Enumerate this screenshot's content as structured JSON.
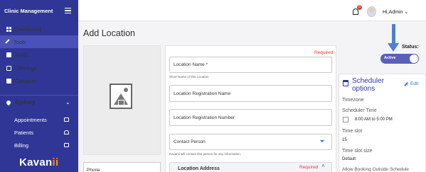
{
  "sidebar": {
    "title": "Clinic Management",
    "items": [
      {
        "label": "Dashboard",
        "icon": "dashboard-icon"
      },
      {
        "label": "Tools",
        "icon": "wrench-icon"
      },
      {
        "label": "Staffs",
        "icon": "staff-icon"
      },
      {
        "label": "Offerings",
        "icon": "offerings-icon"
      },
      {
        "label": "Contacts",
        "icon": "contacts-icon"
      }
    ],
    "location": "Sydney",
    "sub_items": [
      {
        "label": "Appointments",
        "icon": "calendar-icon"
      },
      {
        "label": "Patients",
        "icon": "people-icon"
      },
      {
        "label": "Billing",
        "icon": "card-icon"
      }
    ],
    "logo_main": "Kavan",
    "logo_accent": "ii"
  },
  "topbar": {
    "notification_count": "0",
    "user_greeting": "Hi,Admin"
  },
  "page": {
    "title": "Add Location"
  },
  "form": {
    "required_label": "Required",
    "location_name_placeholder": "Location Name *",
    "location_name_hint": "Short Name of this Location",
    "registration_name_placeholder": "Location Registration Name",
    "registration_number_placeholder": "Location Registration Number",
    "contact_person_placeholder": "Contact Person",
    "contact_hint": "Kavanii will contact this person for any information.",
    "phone_placeholder": "Phone",
    "address_section": "Location Address",
    "address_required": "Required"
  },
  "status": {
    "label": "Status:",
    "value": "Active"
  },
  "scheduler": {
    "title": "Scheduler options",
    "edit_label": "Edit",
    "timezone_label": "Timezone",
    "scheduler_time_label": "Scheduler Time",
    "scheduler_time_value": "8:00 AM to 5:00 PM",
    "time_slot_label": "Time slot",
    "time_slot_value": "15",
    "time_slot_size_label": "Time slot size",
    "time_slot_size_value": "Default",
    "booking_label": "Allow Booking Outside Schedule"
  },
  "colors": {
    "sidebar": "#2f3695",
    "accent": "#2f6fd6",
    "required": "#e53935",
    "logo_accent": "#f7941d"
  }
}
